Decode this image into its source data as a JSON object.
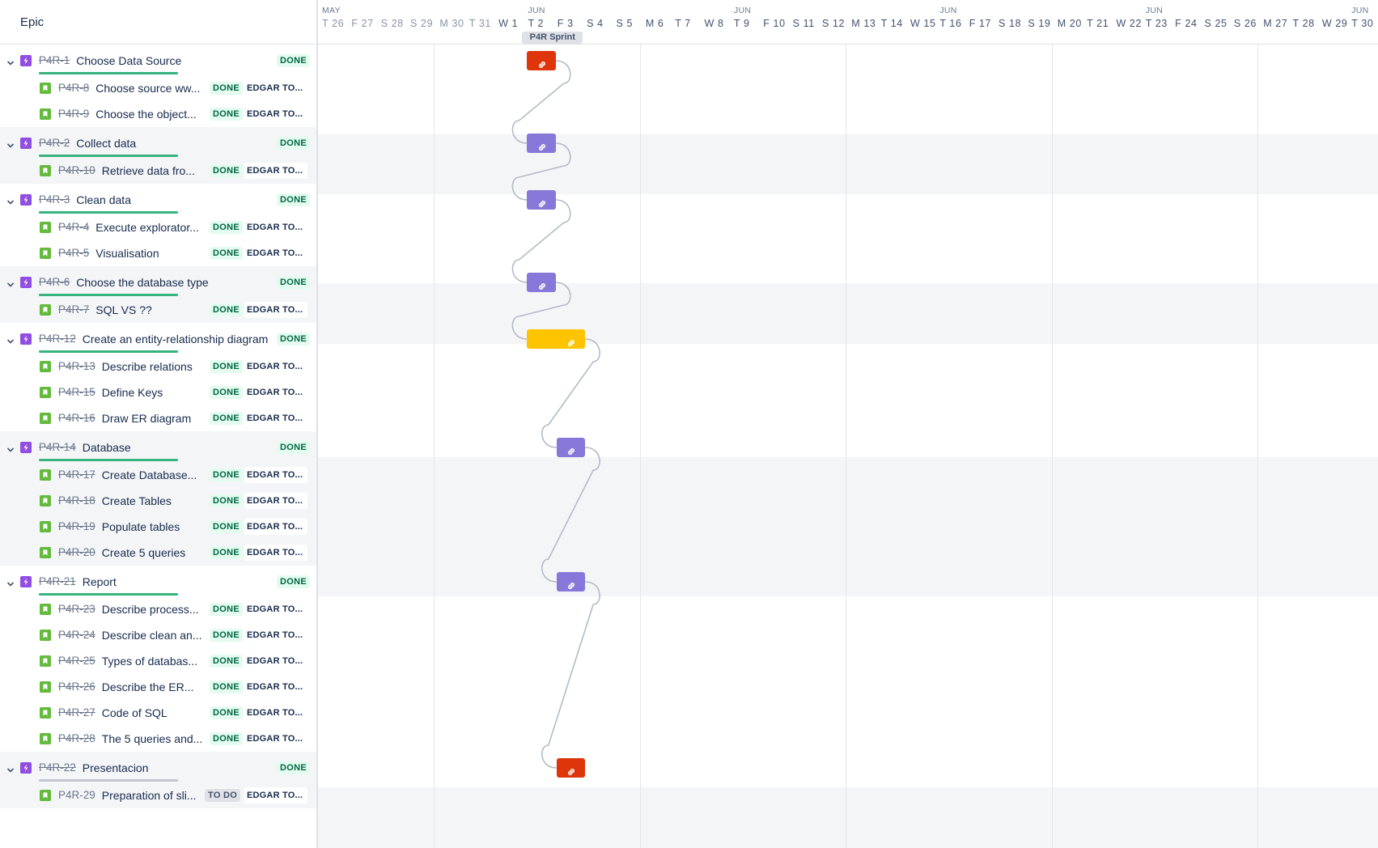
{
  "colors": {
    "done_bar": "#36b37e",
    "todo_bar": "#c1c7d0",
    "red_bar": "#de350b",
    "purple_bar": "#8777d9",
    "yellow_bar": "#ffc400"
  },
  "left_panel": {
    "header_title": "Epic"
  },
  "timeline": {
    "months": [
      {
        "label": "MAY"
      },
      {
        "label": "JUN"
      },
      {
        "label": "JUN"
      },
      {
        "label": "JUN"
      },
      {
        "label": "JUN"
      },
      {
        "label": "JUN"
      }
    ],
    "days": [
      "T 26",
      "F 27",
      "S 28",
      "S 29",
      "M 30",
      "T 31",
      "W 1",
      "T 2",
      "F 3",
      "S 4",
      "S 5",
      "M 6",
      "T 7",
      "W 8",
      "T 9",
      "F 10",
      "S 11",
      "S 12",
      "M 13",
      "T 14",
      "W 15",
      "T 16",
      "F 17",
      "S 18",
      "S 19",
      "M 20",
      "T 21",
      "W 22",
      "T 23",
      "F 24",
      "S 25",
      "S 26",
      "M 27",
      "T 28",
      "W 29",
      "T 30"
    ],
    "past_day_count": 6,
    "sprint_label": "P4R Sprint"
  },
  "rows": [
    {
      "type": "epic",
      "key": "P4R-1",
      "title": "Choose Data Source",
      "status": "DONE",
      "progress": 1
    },
    {
      "type": "story",
      "key": "P4R-8",
      "title": "Choose source ww...",
      "status": "DONE",
      "assignee": "EDGAR TO..."
    },
    {
      "type": "story",
      "key": "P4R-9",
      "title": "Choose the object...",
      "status": "DONE",
      "assignee": "EDGAR TO..."
    },
    {
      "type": "epic",
      "key": "P4R-2",
      "title": "Collect data",
      "status": "DONE",
      "progress": 1
    },
    {
      "type": "story",
      "key": "P4R-10",
      "title": "Retrieve data fro...",
      "status": "DONE",
      "assignee": "EDGAR TO..."
    },
    {
      "type": "epic",
      "key": "P4R-3",
      "title": "Clean data",
      "status": "DONE",
      "progress": 1
    },
    {
      "type": "story",
      "key": "P4R-4",
      "title": "Execute explorator...",
      "status": "DONE",
      "assignee": "EDGAR TO..."
    },
    {
      "type": "story",
      "key": "P4R-5",
      "title": "Visualisation",
      "status": "DONE",
      "assignee": "EDGAR TO..."
    },
    {
      "type": "epic",
      "key": "P4R-6",
      "title": "Choose the database type",
      "status": "DONE",
      "progress": 1
    },
    {
      "type": "story",
      "key": "P4R-7",
      "title": "SQL VS ??",
      "status": "DONE",
      "assignee": "EDGAR TO..."
    },
    {
      "type": "epic",
      "key": "P4R-12",
      "title": "Create an entity-relationship diagram",
      "status": "DONE",
      "progress": 1
    },
    {
      "type": "story",
      "key": "P4R-13",
      "title": "Describe relations",
      "status": "DONE",
      "assignee": "EDGAR TO..."
    },
    {
      "type": "story",
      "key": "P4R-15",
      "title": "Define Keys",
      "status": "DONE",
      "assignee": "EDGAR TO..."
    },
    {
      "type": "story",
      "key": "P4R-16",
      "title": "Draw ER diagram",
      "status": "DONE",
      "assignee": "EDGAR TO..."
    },
    {
      "type": "epic",
      "key": "P4R-14",
      "title": "Database",
      "status": "DONE",
      "progress": 1
    },
    {
      "type": "story",
      "key": "P4R-17",
      "title": "Create Database...",
      "status": "DONE",
      "assignee": "EDGAR TO..."
    },
    {
      "type": "story",
      "key": "P4R-18",
      "title": "Create Tables",
      "status": "DONE",
      "assignee": "EDGAR TO..."
    },
    {
      "type": "story",
      "key": "P4R-19",
      "title": "Populate tables",
      "status": "DONE",
      "assignee": "EDGAR TO..."
    },
    {
      "type": "story",
      "key": "P4R-20",
      "title": "Create 5 queries",
      "status": "DONE",
      "assignee": "EDGAR TO..."
    },
    {
      "type": "epic",
      "key": "P4R-21",
      "title": "Report",
      "status": "DONE",
      "progress": 1
    },
    {
      "type": "story",
      "key": "P4R-23",
      "title": "Describe process...",
      "status": "DONE",
      "assignee": "EDGAR TO..."
    },
    {
      "type": "story",
      "key": "P4R-24",
      "title": "Describe clean an...",
      "status": "DONE",
      "assignee": "EDGAR TO..."
    },
    {
      "type": "story",
      "key": "P4R-25",
      "title": "Types of databas...",
      "status": "DONE",
      "assignee": "EDGAR TO..."
    },
    {
      "type": "story",
      "key": "P4R-26",
      "title": "Describe the ER...",
      "status": "DONE",
      "assignee": "EDGAR TO..."
    },
    {
      "type": "story",
      "key": "P4R-27",
      "title": "Code of SQL",
      "status": "DONE",
      "assignee": "EDGAR TO..."
    },
    {
      "type": "story",
      "key": "P4R-28",
      "title": "The 5 queries and...",
      "status": "DONE",
      "assignee": "EDGAR TO..."
    },
    {
      "type": "epic",
      "key": "P4R-22",
      "title": "Presentacion",
      "status": "DONE",
      "progress": 0
    },
    {
      "type": "story",
      "key": "P4R-29",
      "title": "Preparation of sli...",
      "status": "TO DO",
      "assignee": "EDGAR TO...",
      "open": true
    }
  ],
  "bars": [
    {
      "epic": "P4R-1",
      "color": "red",
      "start_day": "T 2",
      "end_day": "T 2"
    },
    {
      "epic": "P4R-2",
      "color": "purple",
      "start_day": "T 2",
      "end_day": "T 2"
    },
    {
      "epic": "P4R-3",
      "color": "purple",
      "start_day": "T 2",
      "end_day": "T 2"
    },
    {
      "epic": "P4R-6",
      "color": "purple",
      "start_day": "T 2",
      "end_day": "T 2"
    },
    {
      "epic": "P4R-12",
      "color": "yellow",
      "start_day": "T 2",
      "end_day": "F 3"
    },
    {
      "epic": "P4R-14",
      "color": "purple",
      "start_day": "F 3",
      "end_day": "F 3"
    },
    {
      "epic": "P4R-21",
      "color": "purple",
      "start_day": "F 3",
      "end_day": "F 3"
    },
    {
      "epic": "P4R-22",
      "color": "red",
      "start_day": "F 3",
      "end_day": "F 3"
    }
  ]
}
